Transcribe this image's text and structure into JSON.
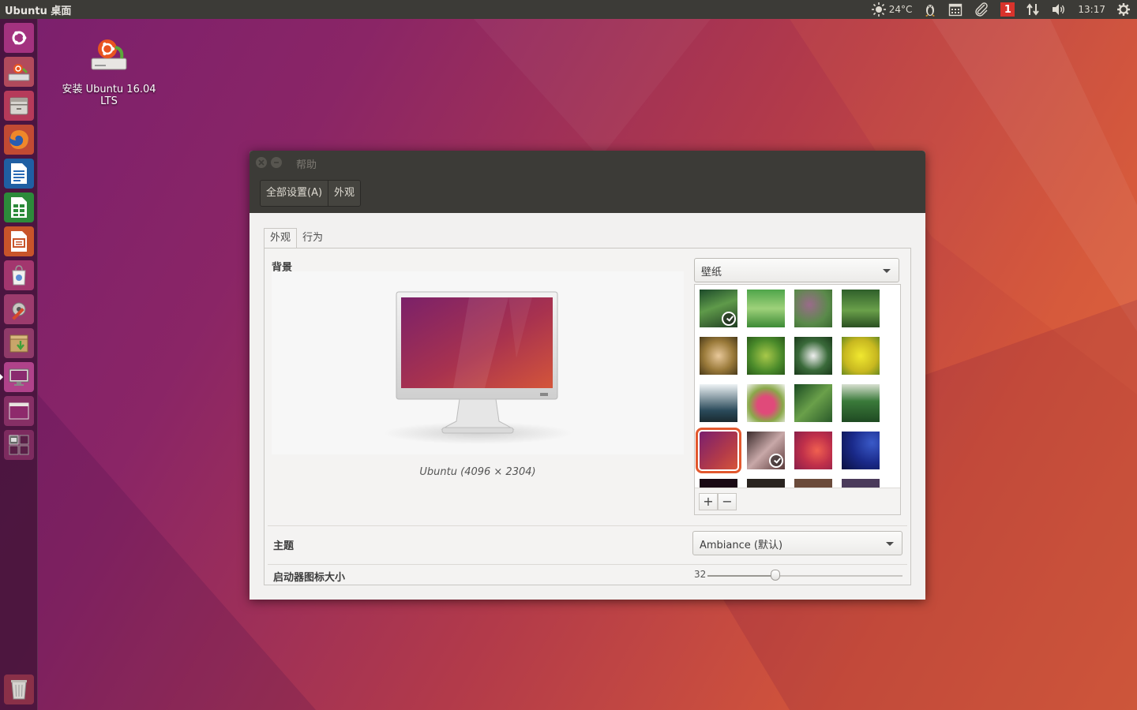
{
  "top_panel": {
    "app_title": "Ubuntu 桌面",
    "weather": "24°C",
    "notification_count": "1",
    "clock": "13:17",
    "indicator_icons": [
      "weather-icon",
      "qq-penguin-icon",
      "calendar-icon",
      "paperclip-icon",
      "notification-badge",
      "network-icon",
      "volume-icon",
      "session-gear-icon"
    ]
  },
  "launcher": {
    "items": [
      "dash-home-icon",
      "ubuntu-installer-icon",
      "files-icon",
      "firefox-icon",
      "libreoffice-writer-icon",
      "libreoffice-calc-icon",
      "libreoffice-impress-icon",
      "software-center-icon",
      "system-settings-icon",
      "archive-manager-icon",
      "display-settings-icon",
      "window-icon",
      "workspace-switcher-icon",
      "trash-icon"
    ]
  },
  "desktop": {
    "install_icon_label": "安装 Ubuntu 16.04 LTS"
  },
  "window": {
    "title": "帮助",
    "breadcrumb": [
      "全部设置(A)",
      "外观"
    ],
    "tabs": [
      "外观",
      "行为"
    ],
    "background_label": "背景",
    "wallpaper_caption": "Ubuntu (4096 × 2304)",
    "wallpaper_source": "壁纸",
    "add_button": "+",
    "remove_button": "−",
    "theme_label": "主题",
    "theme_value": "Ambiance (默认)",
    "launcher_size_label": "启动器图标大小",
    "launcher_size_value": "32",
    "launcher_size_fraction": 0.35
  }
}
